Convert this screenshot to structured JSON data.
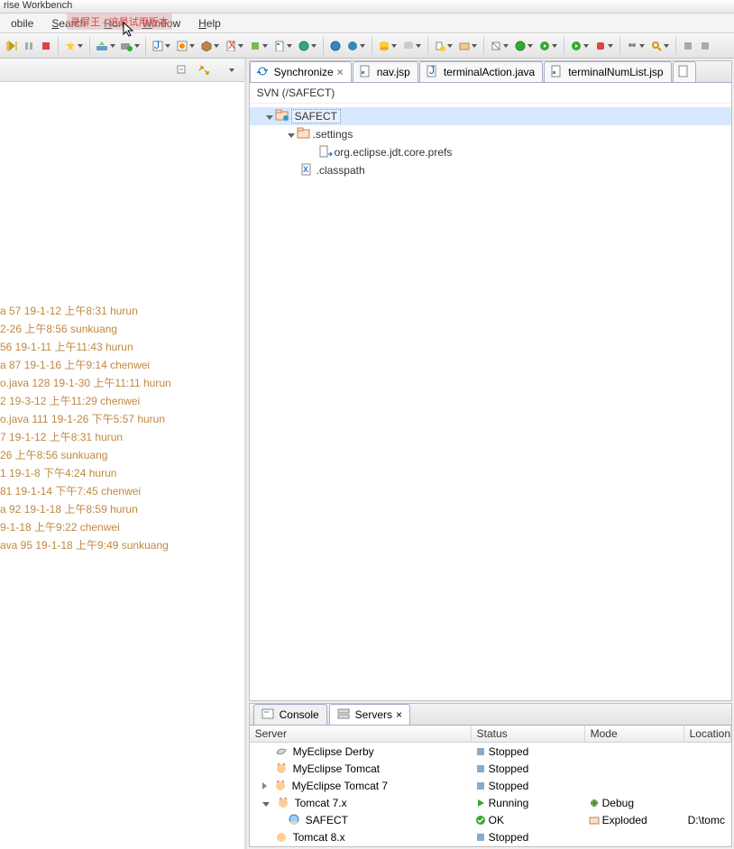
{
  "window": {
    "title": "rise Workbench"
  },
  "watermark": "录屏王 - 这是试用版本",
  "menu": {
    "mobile": "obile",
    "search": "Search",
    "run": "Run",
    "window": "Window",
    "help": "Help"
  },
  "editor_tabs": {
    "sync": "Synchronize",
    "nav": "nav.jsp",
    "action": "terminalAction.java",
    "list": "terminalNumList.jsp"
  },
  "sync": {
    "root": "SVN (/SAFECT)",
    "project": "SAFECT",
    "settings": ".settings",
    "prefs": "org.eclipse.jdt.core.prefs",
    "classpath": ".classpath"
  },
  "history": [
    "a 57  19-1-12 上午8:31  hurun",
    "2-26 上午8:56  sunkuang",
    "  56  19-1-11 上午11:43  hurun",
    "a 87  19-1-16 上午9:14  chenwei",
    "o.java 128  19-1-30 上午11:11  hurun",
    "2  19-3-12 上午11:29  chenwei",
    "o.java 111  19-1-26 下午5:57  hurun",
    "7  19-1-12 上午8:31  hurun",
    "26 上午8:56  sunkuang",
    "1  19-1-8 下午4:24  hurun",
    "81  19-1-14 下午7:45  chenwei",
    "a 92  19-1-18 上午8:59  hurun",
    "9-1-18 上午9:22  chenwei",
    "ava 95  19-1-18 上午9:49  sunkuang"
  ],
  "bottom_tabs": {
    "console": "Console",
    "servers": "Servers"
  },
  "servers": {
    "headers": {
      "server": "Server",
      "status": "Status",
      "mode": "Mode",
      "location": "Location"
    },
    "rows": [
      {
        "name": "MyEclipse Derby",
        "status": "Stopped",
        "mode": "",
        "loc": ""
      },
      {
        "name": "MyEclipse Tomcat",
        "status": "Stopped",
        "mode": "",
        "loc": ""
      },
      {
        "name": "MyEclipse Tomcat 7",
        "status": "Stopped",
        "mode": "",
        "loc": ""
      },
      {
        "name": "Tomcat  7.x",
        "status": "Running",
        "mode": "Debug",
        "loc": ""
      },
      {
        "name": "SAFECT",
        "status": "OK",
        "mode": "Exploded",
        "loc": "D:\\tomc"
      },
      {
        "name": "Tomcat  8.x",
        "status": "Stopped",
        "mode": "",
        "loc": ""
      }
    ]
  },
  "colors": {
    "selection": "#d6e8ff",
    "link_meta": "#c08840"
  }
}
